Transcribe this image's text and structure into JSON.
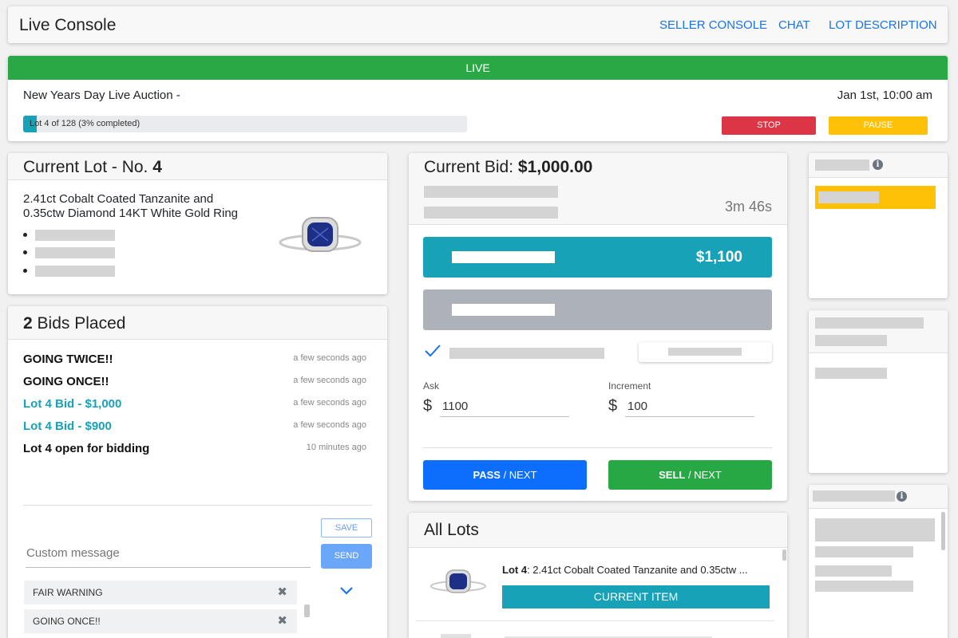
{
  "header": {
    "title": "Live Console",
    "nav": {
      "seller_console": "SELLER CONSOLE",
      "chat": "CHAT",
      "lot_description": "LOT DESCRIPTION"
    }
  },
  "status": {
    "live_label": "LIVE",
    "auction_name": "New Years Day Live Auction -",
    "date": "Jan 1st, 10:00 am",
    "progress_text": "Lot 4 of 128 (3% completed)",
    "progress_fraction": 0.03,
    "stop_label": "STOP",
    "pause_label": "PAUSE"
  },
  "current_lot": {
    "title_prefix": "Current Lot - No.",
    "number": "4",
    "description": "2.41ct Cobalt Coated Tanzanite and 0.35ctw Diamond 14KT White Gold Ring"
  },
  "bids": {
    "count": "2",
    "title_suffix": "Bids Placed",
    "events": [
      {
        "text": "GOING TWICE!!",
        "time": "a few seconds ago",
        "style": "dark"
      },
      {
        "text": "GOING ONCE!!",
        "time": "a few seconds ago",
        "style": "dark"
      },
      {
        "text": "Lot 4 Bid - $1,000",
        "time": "a few seconds ago",
        "style": "teal"
      },
      {
        "text": "Lot 4 Bid - $900",
        "time": "a few seconds ago",
        "style": "teal"
      },
      {
        "text": "Lot 4 open for bidding",
        "time": "10 minutes ago",
        "style": "dark"
      }
    ],
    "custom_placeholder": "Custom message",
    "save_label": "SAVE",
    "send_label": "SEND",
    "quick_messages": [
      "FAIR WARNING",
      "GOING ONCE!!"
    ]
  },
  "bidding": {
    "title_prefix": "Current Bid:",
    "current_bid": "$1,000.00",
    "timer": "3m 46s",
    "next_bid": "$1,100",
    "ask_label": "Ask",
    "ask_value": "1100",
    "increment_label": "Increment",
    "increment_value": "100",
    "currency": "$",
    "pass_bold": "PASS",
    "pass_rest": " / NEXT",
    "sell_bold": "SELL",
    "sell_rest": " / NEXT"
  },
  "all_lots": {
    "title": "All Lots",
    "items": [
      {
        "lot": "Lot 4",
        "desc": ": 2.41ct Cobalt Coated Tanzanite and 0.35ctw ...",
        "badge": "CURRENT ITEM"
      }
    ]
  },
  "colors": {
    "live": "#2aa845",
    "teal": "#17a2b8",
    "stop": "#dc3545",
    "pause": "#ffc107",
    "pass": "#0d6efd",
    "sell": "#28a745",
    "highlight": "#ffc107"
  }
}
